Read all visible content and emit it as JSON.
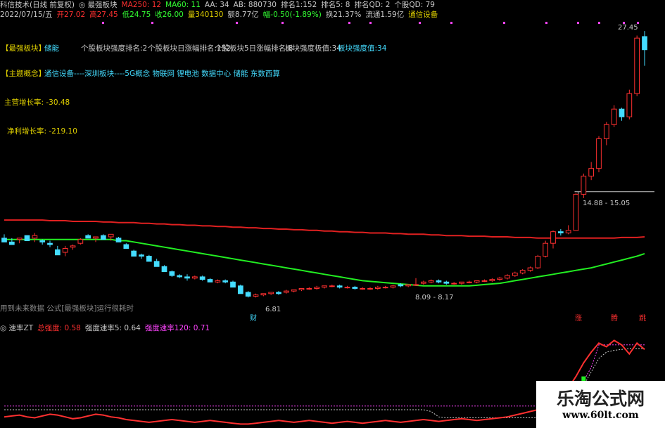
{
  "header": {
    "line1": [
      {
        "text": "科信技术(日线 前复权)",
        "color": "#c8c8c8"
      },
      {
        "text": "◎ 最强板块",
        "color": "#c8c8c8"
      },
      {
        "text": "MA250: 12",
        "color": "#ff3030"
      },
      {
        "text": "MA60: 11",
        "color": "#33ff33"
      },
      {
        "text": "AA: 34",
        "color": "#c8c8c8"
      },
      {
        "text": "AB: 880730",
        "color": "#c8c8c8"
      },
      {
        "text": "排名1:152",
        "color": "#c8c8c8"
      },
      {
        "text": "排名5: 8",
        "color": "#c8c8c8"
      },
      {
        "text": "排名QD: 2",
        "color": "#c8c8c8"
      },
      {
        "text": "个股QD: 79",
        "color": "#c8c8c8"
      }
    ],
    "line2": [
      {
        "text": "2022/07/15/五",
        "color": "#c8c8c8"
      },
      {
        "text": "开27.02",
        "color": "#ff3030"
      },
      {
        "text": "高27.45",
        "color": "#ff3030"
      },
      {
        "text": "低24.75",
        "color": "#33ff33"
      },
      {
        "text": "收26.00",
        "color": "#33ff33"
      },
      {
        "text": "量340130",
        "color": "#e0d000"
      },
      {
        "text": "额8.77亿",
        "color": "#c8c8c8"
      },
      {
        "text": "幅-0.50(-1.89%)",
        "color": "#33ff33"
      },
      {
        "text": "换21.37%",
        "color": "#c8c8c8"
      },
      {
        "text": "流通1.59亿",
        "color": "#c8c8c8"
      },
      {
        "text": "通信设备",
        "color": "#e0d000"
      }
    ]
  },
  "panel": {
    "strongest_label": "【最强板块】",
    "strongest_value": "储能",
    "rank_strength": "个股板块强度排名:2",
    "rank_day": "个股板块日涨幅排名:152",
    "rank_5day": "个股板块5日涨幅排名:8",
    "extreme": "板块强度极值:34",
    "strength": "板块强度值:34",
    "concept_label": "【主题概念】",
    "concept_value": "通信设备----深圳板块----5G概念 物联网 锂电池 数据中心 储能 东数西算",
    "revenue_growth": "主营增长率: -30.48",
    "profit_growth": "净利增长率: -219.10",
    "future_note": "用到未来数据 公式[最强板块]运行很耗时"
  },
  "annotations": {
    "high": "27.45",
    "range1": "14.88 - 15.05",
    "range2": "8.09 - 8.17",
    "low": "6.81",
    "marker_cai": "财",
    "marker_zhang": "涨",
    "marker_teng": "腾",
    "marker_tiao": "跳"
  },
  "subheader": [
    {
      "text": "◎ 速率ZT",
      "color": "#c8c8c8"
    },
    {
      "text": "总强度: 0.58",
      "color": "#ff3030"
    },
    {
      "text": "强度速率5: 0.64",
      "color": "#c8c8c8"
    },
    {
      "text": "强度速率120: 0.71",
      "color": "#ff44ff"
    }
  ],
  "watermark": {
    "title": "乐淘公式网",
    "url": "www.60lt.com"
  },
  "colors": {
    "up": "#ff3030",
    "down": "#44dcff",
    "ma250": "#e02020",
    "ma60": "#22ee22",
    "label": "#e0d000",
    "concept": "#44dcff"
  },
  "chart_data": {
    "type": "candlestick",
    "ylim": [
      6,
      28
    ],
    "candles": [
      [
        11.4,
        11.7,
        11.2,
        11.1
      ],
      [
        11.1,
        11.4,
        10.9,
        10.9
      ],
      [
        11.3,
        11.3,
        11.0,
        11.4
      ],
      [
        11.6,
        11.6,
        11.2,
        11.2
      ],
      [
        11.4,
        11.8,
        11.1,
        11.6
      ],
      [
        11.2,
        11.3,
        10.9,
        11.1
      ],
      [
        11.0,
        11.2,
        10.7,
        10.9
      ],
      [
        10.5,
        10.8,
        10.1,
        10.1
      ],
      [
        10.3,
        10.8,
        10.0,
        10.6
      ],
      [
        10.7,
        10.9,
        10.5,
        10.8
      ],
      [
        11.0,
        11.4,
        10.9,
        11.3
      ],
      [
        11.6,
        11.7,
        11.4,
        11.4
      ],
      [
        11.4,
        11.5,
        11.1,
        11.5
      ],
      [
        11.6,
        11.7,
        11.3,
        11.3
      ],
      [
        11.5,
        11.7,
        11.2,
        11.7
      ],
      [
        11.4,
        11.5,
        11.1,
        11.1
      ],
      [
        10.9,
        11.0,
        10.6,
        10.6
      ],
      [
        10.4,
        10.5,
        10.0,
        10.0
      ],
      [
        10.1,
        10.2,
        9.8,
        10.0
      ],
      [
        10.0,
        10.1,
        9.6,
        9.6
      ],
      [
        9.6,
        9.8,
        9.2,
        9.2
      ],
      [
        9.2,
        9.3,
        8.8,
        8.8
      ],
      [
        8.8,
        8.9,
        8.4,
        8.5
      ],
      [
        8.5,
        8.6,
        8.3,
        8.4
      ],
      [
        8.4,
        8.6,
        8.1,
        8.3
      ],
      [
        8.3,
        8.5,
        8.2,
        8.4
      ],
      [
        8.4,
        8.5,
        8.1,
        8.2
      ],
      [
        8.2,
        8.3,
        8.0,
        8.0
      ],
      [
        8.0,
        8.2,
        7.9,
        8.1
      ],
      [
        8.1,
        8.2,
        7.9,
        8.0
      ],
      [
        8.0,
        8.1,
        7.6,
        7.6
      ],
      [
        7.7,
        7.8,
        7.1,
        7.1
      ],
      [
        7.2,
        7.3,
        6.8,
        6.9
      ],
      [
        6.9,
        7.1,
        6.8,
        7.0
      ],
      [
        7.0,
        7.1,
        6.9,
        7.1
      ],
      [
        7.1,
        7.2,
        7.0,
        7.2
      ],
      [
        7.2,
        7.3,
        7.0,
        7.1
      ],
      [
        7.2,
        7.4,
        7.1,
        7.3
      ],
      [
        7.3,
        7.4,
        7.2,
        7.4
      ],
      [
        7.4,
        7.5,
        7.3,
        7.5
      ],
      [
        7.5,
        7.6,
        7.4,
        7.5
      ],
      [
        7.5,
        7.7,
        7.4,
        7.6
      ],
      [
        7.6,
        7.7,
        7.5,
        7.7
      ],
      [
        7.7,
        7.8,
        7.6,
        7.7
      ],
      [
        7.7,
        7.8,
        7.5,
        7.6
      ],
      [
        7.6,
        7.7,
        7.5,
        7.6
      ],
      [
        7.6,
        7.7,
        7.4,
        7.5
      ],
      [
        7.5,
        7.6,
        7.4,
        7.5
      ],
      [
        7.5,
        7.6,
        7.4,
        7.5
      ],
      [
        7.5,
        7.7,
        7.4,
        7.6
      ],
      [
        7.6,
        7.7,
        7.5,
        7.6
      ],
      [
        7.6,
        7.8,
        7.5,
        7.7
      ],
      [
        7.8,
        7.9,
        7.6,
        7.7
      ],
      [
        7.7,
        7.8,
        7.6,
        7.8
      ],
      [
        7.8,
        8.3,
        7.7,
        7.8
      ],
      [
        7.9,
        8.1,
        7.8,
        8.0
      ],
      [
        8.0,
        8.2,
        7.9,
        8.1
      ],
      [
        8.1,
        8.2,
        7.9,
        8.0
      ],
      [
        8.0,
        8.1,
        7.8,
        7.9
      ],
      [
        7.9,
        8.0,
        7.8,
        7.9
      ],
      [
        7.9,
        8.0,
        7.8,
        8.0
      ],
      [
        8.0,
        8.1,
        7.9,
        8.0
      ],
      [
        8.0,
        8.1,
        7.9,
        8.1
      ],
      [
        8.1,
        8.2,
        8.0,
        8.1
      ],
      [
        8.1,
        8.3,
        8.0,
        8.2
      ],
      [
        8.2,
        8.4,
        8.1,
        8.3
      ],
      [
        8.3,
        8.6,
        8.2,
        8.5
      ],
      [
        8.5,
        8.8,
        8.4,
        8.7
      ],
      [
        8.7,
        9.0,
        8.6,
        8.9
      ],
      [
        8.9,
        9.2,
        8.8,
        9.1
      ],
      [
        9.1,
        10.1,
        9.0,
        10.0
      ],
      [
        10.0,
        11.2,
        9.9,
        11.0
      ],
      [
        11.0,
        12.0,
        10.6,
        11.9
      ],
      [
        11.9,
        12.1,
        11.6,
        11.8
      ],
      [
        11.8,
        12.4,
        11.7,
        12.0
      ],
      [
        12.0,
        14.9,
        12.0,
        14.8
      ],
      [
        14.8,
        16.4,
        14.5,
        16.2
      ],
      [
        16.2,
        17.3,
        15.9,
        16.8
      ],
      [
        16.8,
        19.3,
        16.5,
        19.1
      ],
      [
        19.1,
        20.4,
        18.6,
        20.2
      ],
      [
        20.2,
        21.7,
        20.0,
        21.4
      ],
      [
        21.4,
        21.5,
        20.5,
        20.8
      ],
      [
        20.8,
        22.9,
        20.6,
        22.6
      ],
      [
        22.6,
        27.1,
        22.4,
        26.9
      ],
      [
        27.02,
        27.45,
        24.75,
        26.0
      ]
    ],
    "ma60": [
      11.3,
      11.3,
      11.3,
      11.3,
      11.3,
      11.3,
      11.3,
      11.3,
      11.3,
      11.3,
      11.3,
      11.3,
      11.3,
      11.3,
      11.3,
      11.2,
      11.2,
      11.1,
      11.0,
      10.9,
      10.8,
      10.7,
      10.6,
      10.5,
      10.4,
      10.3,
      10.2,
      10.1,
      10.0,
      9.9,
      9.8,
      9.7,
      9.6,
      9.5,
      9.4,
      9.3,
      9.2,
      9.1,
      9.0,
      8.9,
      8.8,
      8.7,
      8.6,
      8.5,
      8.4,
      8.3,
      8.2,
      8.1,
      8.05,
      8.0,
      7.95,
      7.9,
      7.85,
      7.8,
      7.75,
      7.7,
      7.7,
      7.7,
      7.7,
      7.7,
      7.7,
      7.7,
      7.75,
      7.8,
      7.85,
      7.9,
      8.0,
      8.1,
      8.2,
      8.3,
      8.4,
      8.5,
      8.6,
      8.7,
      8.8,
      8.9,
      9.0,
      9.1,
      9.25,
      9.4,
      9.55,
      9.7,
      9.85,
      10.0,
      10.2
    ],
    "ma250": [
      12.8,
      12.8,
      12.8,
      12.8,
      12.8,
      12.8,
      12.75,
      12.75,
      12.75,
      12.7,
      12.7,
      12.7,
      12.7,
      12.65,
      12.65,
      12.6,
      12.6,
      12.6,
      12.55,
      12.55,
      12.5,
      12.5,
      12.45,
      12.45,
      12.4,
      12.4,
      12.35,
      12.35,
      12.3,
      12.3,
      12.25,
      12.25,
      12.2,
      12.2,
      12.15,
      12.15,
      12.1,
      12.1,
      12.05,
      12.05,
      12.0,
      12.0,
      11.95,
      11.95,
      11.9,
      11.9,
      11.85,
      11.85,
      11.8,
      11.8,
      11.8,
      11.75,
      11.75,
      11.7,
      11.7,
      11.7,
      11.65,
      11.65,
      11.6,
      11.6,
      11.6,
      11.55,
      11.55,
      11.55,
      11.5,
      11.5,
      11.5,
      11.45,
      11.45,
      11.45,
      11.4,
      11.4,
      11.4,
      11.4,
      11.4,
      11.4,
      11.4,
      11.4,
      11.4,
      11.4,
      11.4,
      11.45,
      11.45,
      11.45,
      11.5
    ],
    "sub_total": [
      0.1,
      0.11,
      0.12,
      0.1,
      0.09,
      0.11,
      0.13,
      0.12,
      0.1,
      0.08,
      0.09,
      0.11,
      0.13,
      0.12,
      0.1,
      0.09,
      0.07,
      0.06,
      0.05,
      0.04,
      0.05,
      0.06,
      0.07,
      0.06,
      0.05,
      0.04,
      0.05,
      0.06,
      0.05,
      0.04,
      0.03,
      0.02,
      0.02,
      0.03,
      0.04,
      0.05,
      0.06,
      0.05,
      0.04,
      0.05,
      0.06,
      0.05,
      0.04,
      0.03,
      0.04,
      0.05,
      0.04,
      0.03,
      0.04,
      0.05,
      0.06,
      0.05,
      0.04,
      0.05,
      0.06,
      0.07,
      0.06,
      0.05,
      0.06,
      0.07,
      0.08,
      0.07,
      0.06,
      0.07,
      0.08,
      0.09,
      0.1,
      0.12,
      0.14,
      0.16,
      0.18,
      0.2,
      0.24,
      0.3,
      0.42,
      0.55,
      0.7,
      0.82,
      0.92,
      0.88,
      0.95,
      0.9,
      0.8,
      0.92,
      0.85
    ],
    "sub_rate5": [
      0.18,
      0.18,
      0.18,
      0.18,
      0.18,
      0.18,
      0.18,
      0.18,
      0.18,
      0.18,
      0.18,
      0.18,
      0.18,
      0.18,
      0.18,
      0.18,
      0.18,
      0.18,
      0.18,
      0.18,
      0.18,
      0.18,
      0.18,
      0.18,
      0.18,
      0.18,
      0.18,
      0.18,
      0.18,
      0.18,
      0.18,
      0.18,
      0.18,
      0.18,
      0.18,
      0.18,
      0.18,
      0.18,
      0.18,
      0.18,
      0.18,
      0.18,
      0.18,
      0.18,
      0.18,
      0.18,
      0.18,
      0.18,
      0.18,
      0.18,
      0.18,
      0.18,
      0.18,
      0.18,
      0.18,
      0.18,
      0.16,
      0.1,
      0.09,
      0.09,
      0.09,
      0.09,
      0.09,
      0.09,
      0.09,
      0.09,
      0.09,
      0.09,
      0.09,
      0.09,
      0.09,
      0.09,
      0.1,
      0.12,
      0.18,
      0.3,
      0.45,
      0.6,
      0.75,
      0.82,
      0.84,
      0.85,
      0.86,
      0.86,
      0.86
    ],
    "sub_rate120": [
      0.22,
      0.22,
      0.22,
      0.22,
      0.22,
      0.22,
      0.22,
      0.22,
      0.22,
      0.22,
      0.22,
      0.22,
      0.22,
      0.22,
      0.22,
      0.22,
      0.22,
      0.22,
      0.22,
      0.22,
      0.22,
      0.22,
      0.22,
      0.22,
      0.22,
      0.22,
      0.22,
      0.22,
      0.22,
      0.22,
      0.22,
      0.22,
      0.22,
      0.22,
      0.22,
      0.22,
      0.22,
      0.22,
      0.22,
      0.22,
      0.22,
      0.22,
      0.22,
      0.22,
      0.22,
      0.22,
      0.22,
      0.22,
      0.22,
      0.22,
      0.22,
      0.22,
      0.22,
      0.22,
      0.22,
      0.22,
      0.22,
      0.22,
      0.22,
      0.22,
      0.22,
      0.22,
      0.22,
      0.22,
      0.22,
      0.22,
      0.22,
      0.22,
      0.22,
      0.22,
      0.22,
      0.22,
      0.22,
      0.22,
      0.25,
      0.35,
      0.5,
      0.65,
      0.9,
      0.9,
      0.9,
      0.9,
      0.9,
      0.9,
      0.9
    ]
  }
}
